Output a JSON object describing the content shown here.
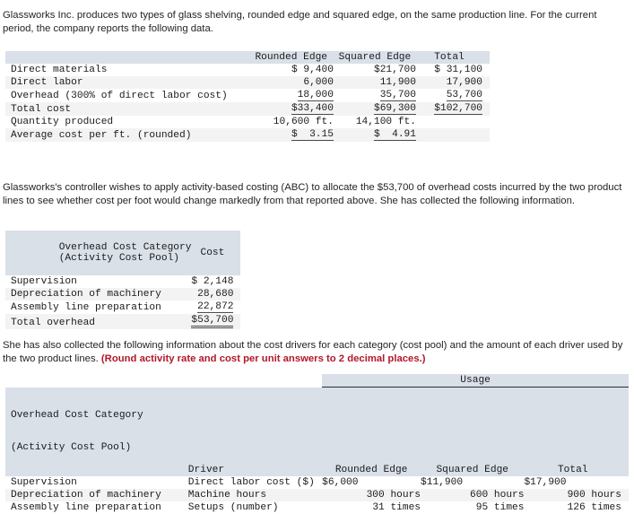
{
  "paragraphs": {
    "intro": "Glassworks Inc. produces two types of glass shelving, rounded edge and squared edge, on the same production line. For the current period, the company reports the following data.",
    "abc_context": "Glassworks's controller wishes to apply activity-based costing (ABC) to allocate the $53,700 of overhead costs incurred by the two product lines to see whether cost per foot would change markedly from that reported above. She has collected the following information.",
    "drivers_intro": "She has also collected the following information about the cost drivers for each category (cost pool) and the amount of each driver used by the two product lines.",
    "drivers_emphasis": "(Round activity rate and cost per unit answers to 2 decimal places.)"
  },
  "table_production_cost": {
    "headers": [
      "",
      "Rounded Edge",
      "Squared Edge",
      "Total"
    ],
    "rows": [
      {
        "label": "Direct materials",
        "rounded": "$ 9,400",
        "squared": "$21,700",
        "total": "$ 31,100"
      },
      {
        "label": "Direct labor",
        "rounded": "6,000",
        "squared": "11,900",
        "total": "17,900"
      },
      {
        "label": "Overhead (300% of direct labor cost)",
        "rounded": "18,000",
        "squared": "35,700",
        "total": "53,700"
      },
      {
        "label": "Total cost",
        "rounded": "$33,400",
        "squared": "$69,300",
        "total": "$102,700"
      },
      {
        "label": "Quantity produced",
        "rounded": "10,600 ft.",
        "squared": "14,100 ft.",
        "total": ""
      },
      {
        "label": "Average cost per ft. (rounded)",
        "rounded": "$  3.15",
        "squared": "$  4.91",
        "total": ""
      }
    ]
  },
  "table_overhead_pools": {
    "header_category_line1": "Overhead Cost Category",
    "header_category_line2": "(Activity Cost Pool)",
    "header_cost": "Cost",
    "rows": [
      {
        "category": "Supervision",
        "cost": "$ 2,148"
      },
      {
        "category": "Depreciation of machinery",
        "cost": "28,680"
      },
      {
        "category": "Assembly line preparation",
        "cost": "22,872"
      },
      {
        "category": "Total overhead",
        "cost": "$53,700"
      }
    ]
  },
  "table_cost_drivers": {
    "usage_group_header": "Usage",
    "header_category_line1": "Overhead Cost Category",
    "header_category_line2": "(Activity Cost Pool)",
    "header_driver": "Driver",
    "header_rounded": "Rounded Edge",
    "header_squared": "Squared Edge",
    "header_total": "Total",
    "rows": [
      {
        "category": "Supervision",
        "driver": "Direct labor cost ($)",
        "rounded": "$6,000",
        "squared": "$11,900",
        "total": "$17,900"
      },
      {
        "category": "Depreciation of machinery",
        "driver": "Machine hours",
        "rounded": "300 hours",
        "squared": "600 hours",
        "total": "900 hours"
      },
      {
        "category": "Assembly line preparation",
        "driver": "Setups (number)",
        "rounded": "31 times",
        "squared": "95 times",
        "total": "126 times"
      }
    ]
  },
  "colors": {
    "header_background": "#d9e0e8",
    "stripe_background": "#f3f3f3",
    "emphasis_text": "#b2182b",
    "body_text": "#231f20"
  }
}
